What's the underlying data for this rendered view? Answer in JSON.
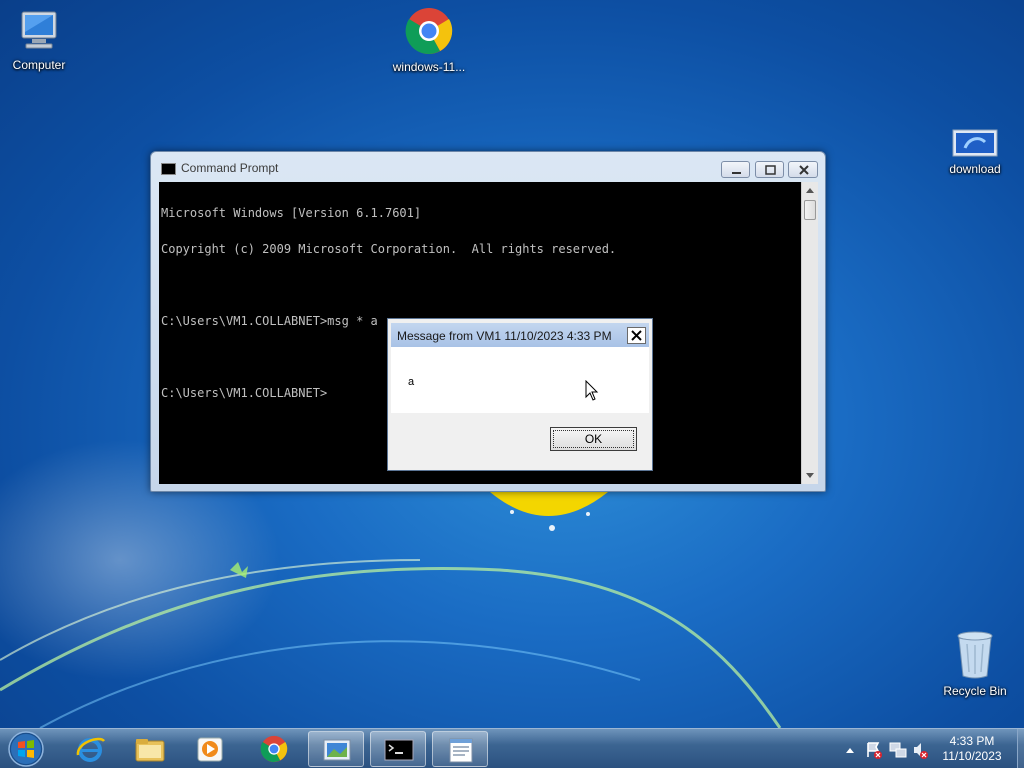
{
  "desktop": {
    "icons": [
      {
        "label": "Computer",
        "icon": "computer-icon"
      },
      {
        "label": "windows-11...",
        "icon": "chrome-icon"
      },
      {
        "label": "download",
        "icon": "image-file-icon"
      },
      {
        "label": "Recycle Bin",
        "icon": "recycle-bin-icon"
      }
    ]
  },
  "cmd": {
    "title": "Command Prompt",
    "lines": [
      "Microsoft Windows [Version 6.1.7601]",
      "Copyright (c) 2009 Microsoft Corporation.  All rights reserved.",
      "",
      "C:\\Users\\VM1.COLLABNET>msg * a",
      "",
      "C:\\Users\\VM1.COLLABNET>"
    ]
  },
  "msgbox": {
    "title": "Message from VM1 11/10/2023 4:33 PM",
    "message": "a",
    "ok_label": "OK"
  },
  "taskbar": {
    "items": [
      {
        "name": "internet-explorer",
        "active": false
      },
      {
        "name": "file-explorer",
        "active": false
      },
      {
        "name": "media-player",
        "active": false
      },
      {
        "name": "chrome",
        "active": false
      },
      {
        "name": "image-viewer",
        "active": true
      },
      {
        "name": "command-prompt",
        "active": true
      },
      {
        "name": "notepad-window",
        "active": true
      }
    ],
    "clock_time": "4:33 PM",
    "clock_date": "11/10/2023"
  },
  "colors": {
    "desktop_bg": "#1a6cc4",
    "console_bg": "#000000",
    "console_fg": "#c0c0c0"
  }
}
